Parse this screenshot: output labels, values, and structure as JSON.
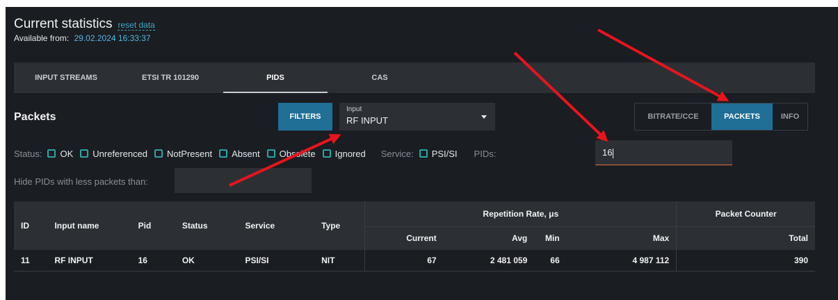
{
  "header": {
    "title": "Current statistics",
    "reset_label": "reset data",
    "available_label": "Available from:",
    "available_date": "29.02.2024 16:33:37"
  },
  "tabs": [
    {
      "label": "INPUT STREAMS",
      "active": false
    },
    {
      "label": "ETSI TR 101290",
      "active": false
    },
    {
      "label": "PIDS",
      "active": true
    },
    {
      "label": "CAS",
      "active": false
    }
  ],
  "section": {
    "title": "Packets"
  },
  "filters": {
    "button_label": "FILTERS",
    "input_select": {
      "label": "Input",
      "value": "RF INPUT"
    }
  },
  "view_toggle": [
    {
      "label": "BITRATE/CCE",
      "active": false
    },
    {
      "label": "PACKETS",
      "active": true
    },
    {
      "label": "INFO",
      "active": false
    }
  ],
  "status_filter": {
    "label": "Status:",
    "options": [
      "OK",
      "Unreferenced",
      "NotPresent",
      "Absent",
      "Obsolete",
      "Ignored"
    ]
  },
  "service_filter": {
    "label": "Service:",
    "options": [
      "PSI/SI"
    ]
  },
  "pids_filter": {
    "label": "PIDs:",
    "value": "16"
  },
  "hide_filter": {
    "label": "Hide PIDs with less packets than:",
    "value": ""
  },
  "table": {
    "columns": {
      "id": "ID",
      "input_name": "Input name",
      "pid": "Pid",
      "status": "Status",
      "service": "Service",
      "type": "Type",
      "repetition_group": "Repetition Rate, μs",
      "current": "Current",
      "avg": "Avg",
      "min": "Min",
      "max": "Max",
      "packet_group": "Packet Counter",
      "total": "Total"
    },
    "rows": [
      {
        "id": "11",
        "input_name": "RF INPUT",
        "pid": "16",
        "status": "OK",
        "service": "PSI/SI",
        "type": "NIT",
        "current": "67",
        "avg": "2 481 059",
        "min": "66",
        "max": "4 987 112",
        "total": "390"
      }
    ]
  },
  "annotation_color": "#e8141c"
}
